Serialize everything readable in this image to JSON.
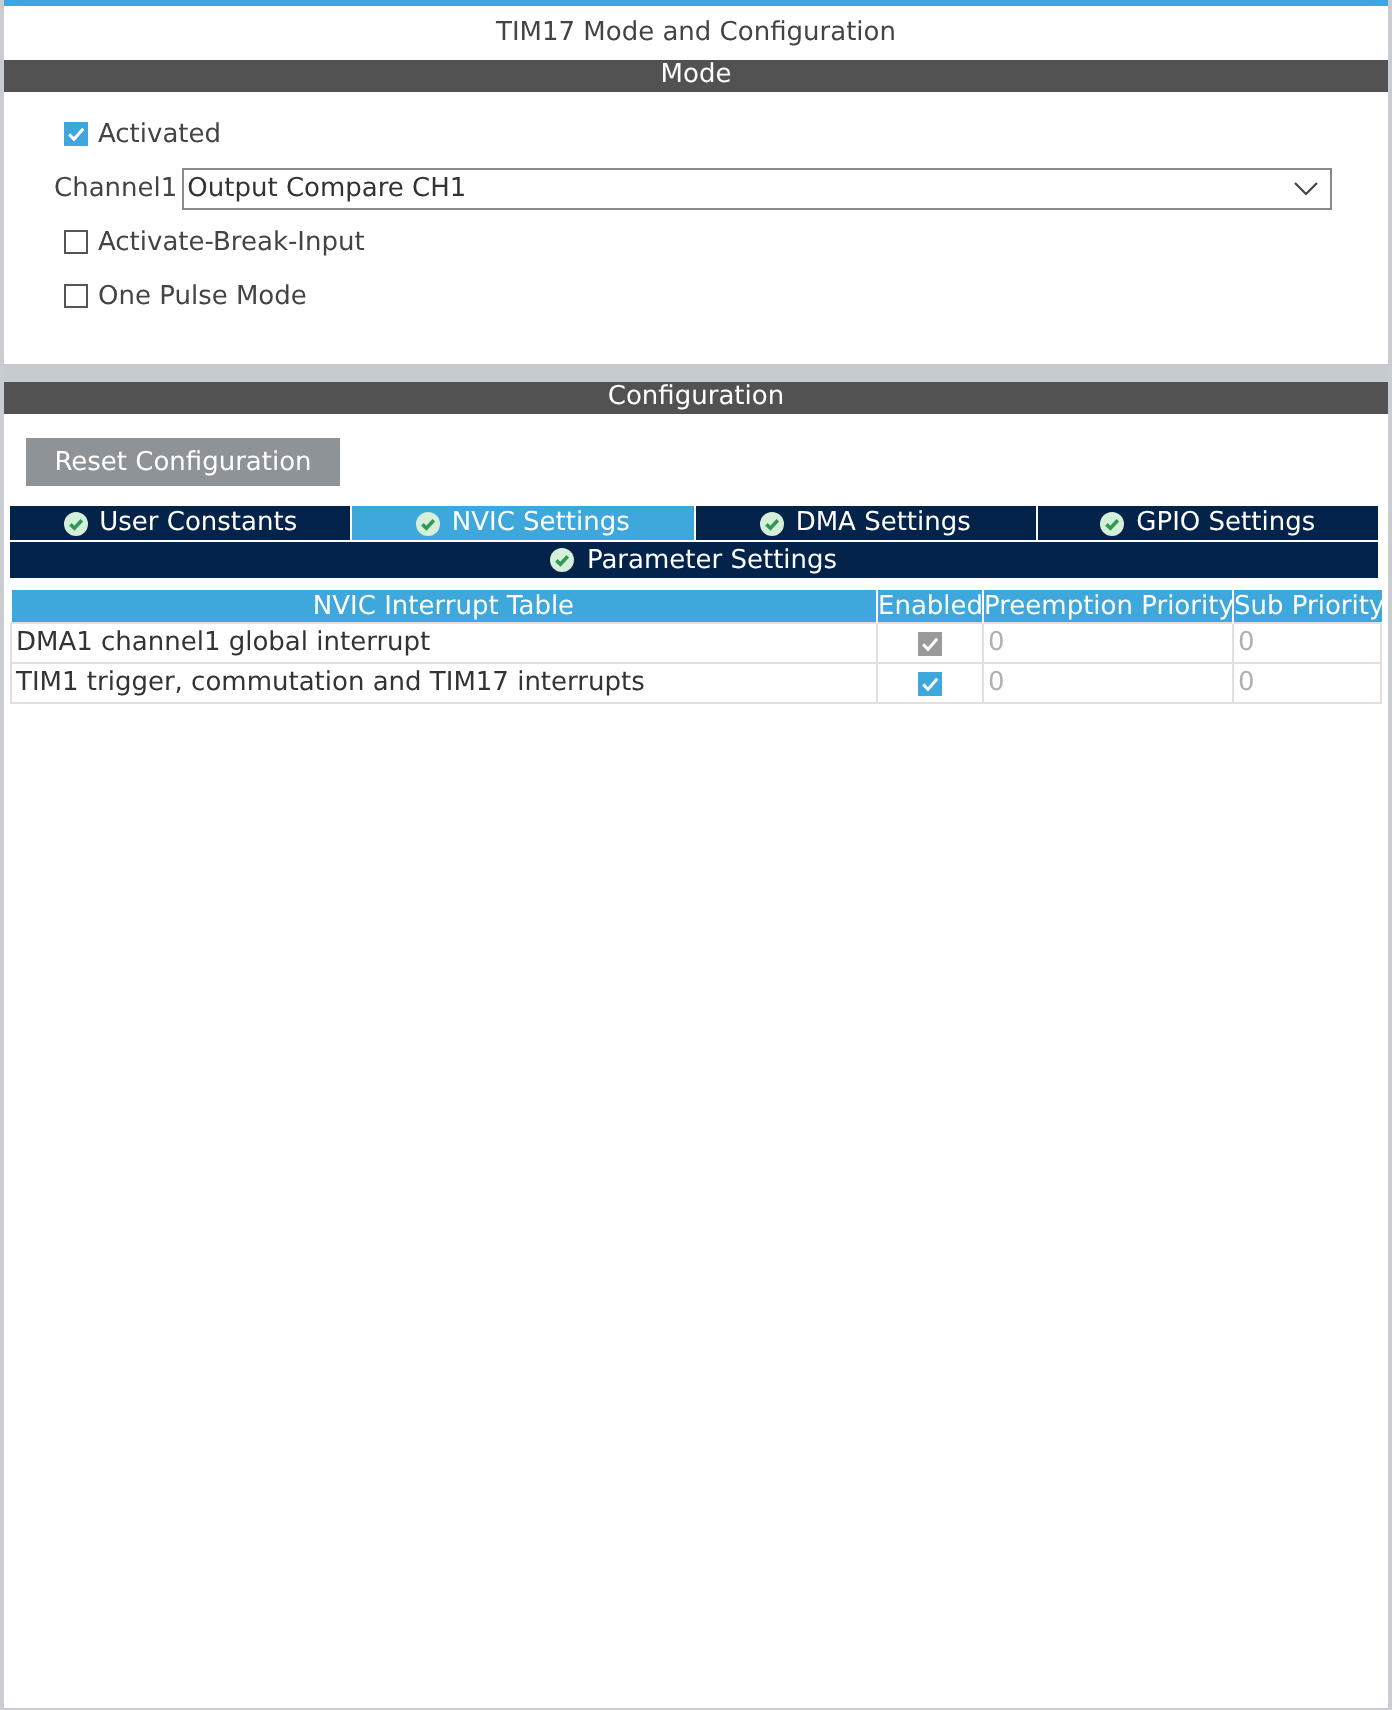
{
  "window": {
    "title": "TIM17 Mode and Configuration"
  },
  "mode": {
    "header": "Mode",
    "fields": [
      {
        "kind": "checkbox",
        "label": "Activated",
        "checked": true
      },
      {
        "kind": "select",
        "label": "Channel1",
        "value": "Output Compare CH1"
      },
      {
        "kind": "checkbox",
        "label": "Activate-Break-Input",
        "checked": false
      },
      {
        "kind": "checkbox",
        "label": "One Pulse Mode",
        "checked": false
      }
    ]
  },
  "configuration": {
    "header": "Configuration",
    "reset_button": "Reset Configuration",
    "tab_rows": [
      [
        {
          "label": "User Constants",
          "selected": false
        },
        {
          "label": "NVIC Settings",
          "selected": true
        },
        {
          "label": "DMA Settings",
          "selected": false
        },
        {
          "label": "GPIO Settings",
          "selected": false
        }
      ],
      [
        {
          "label": "Parameter Settings",
          "selected": false
        }
      ]
    ],
    "table": {
      "columns": [
        "NVIC Interrupt Table",
        "Enabled",
        "Preemption Priority",
        "Sub Priority"
      ],
      "rows": [
        {
          "interrupt": "DMA1 channel1 global interrupt",
          "enabled": true,
          "disabled": true,
          "preemption_priority": "0",
          "sub_priority": "0"
        },
        {
          "interrupt": "TIM1 trigger, commutation and TIM17 interrupts",
          "enabled": true,
          "disabled": false,
          "preemption_priority": "0",
          "sub_priority": "0"
        }
      ]
    }
  }
}
